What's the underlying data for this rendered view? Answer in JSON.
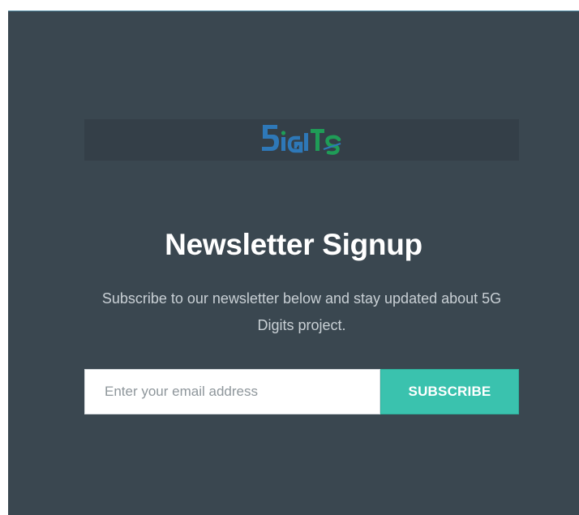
{
  "logo": {
    "text": "5iGITs",
    "icon": "5g-digits-logo",
    "colors": {
      "blue": "#2e78b8",
      "green": "#1f9c57"
    }
  },
  "newsletter": {
    "title": "Newsletter Signup",
    "description": "Subscribe to our newsletter below and stay updated about 5G Digits project.",
    "email_placeholder": "Enter your email address",
    "subscribe_label": "SUBSCRIBE"
  },
  "colors": {
    "panel_background": "#3a4750",
    "accent": "#3ac2ae"
  }
}
